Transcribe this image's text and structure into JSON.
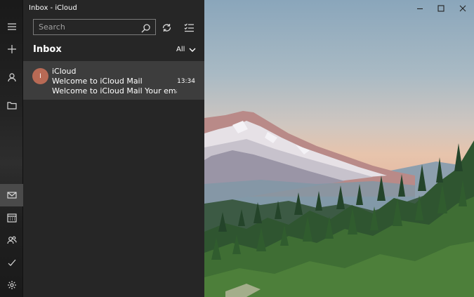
{
  "window": {
    "title": "Inbox - iCloud"
  },
  "rail": {
    "items": [
      {
        "icon": "hamburger-icon"
      },
      {
        "icon": "new-mail-icon"
      },
      {
        "icon": "account-icon"
      },
      {
        "icon": "folder-icon"
      },
      {
        "icon": "mail-icon"
      },
      {
        "icon": "calendar-icon"
      },
      {
        "icon": "people-icon"
      },
      {
        "icon": "todo-icon"
      },
      {
        "icon": "settings-icon"
      }
    ]
  },
  "search": {
    "placeholder": "Search"
  },
  "folder": {
    "title": "Inbox",
    "filter_label": "All"
  },
  "messages": [
    {
      "avatar_initial": "I",
      "sender": "iCloud",
      "subject": "Welcome to iCloud Mail",
      "preview": "Welcome to iCloud Mail Your email addr",
      "time": "13:34"
    }
  ],
  "colors": {
    "avatar": "#b86a55",
    "selected_row": "#3d3d3d",
    "pane": "#262626"
  }
}
